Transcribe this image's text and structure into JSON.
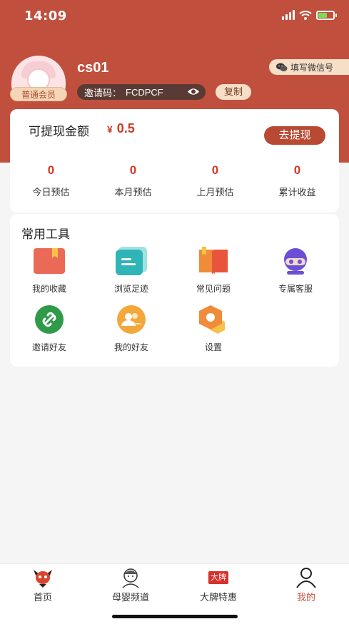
{
  "status_bar": {
    "time": "14:09"
  },
  "profile": {
    "username": "cs01",
    "member_level": "普通会员",
    "invite_label": "邀请码：",
    "invite_code": "FCDPCF",
    "copy_label": "复制",
    "wechat_label": "填写微信号"
  },
  "earnings": {
    "title": "可提现金额",
    "currency": "¥",
    "amount": "0.5",
    "withdraw_label": "去提现",
    "stats": [
      {
        "value": "0",
        "label": "今日预估"
      },
      {
        "value": "0",
        "label": "本月预估"
      },
      {
        "value": "0",
        "label": "上月预估"
      },
      {
        "value": "0",
        "label": "累计收益"
      }
    ]
  },
  "tools": {
    "title": "常用工具",
    "items": [
      {
        "label": "我的收藏",
        "icon": "bookmark-icon"
      },
      {
        "label": "浏览足迹",
        "icon": "history-icon"
      },
      {
        "label": "常见问题",
        "icon": "faq-book-icon"
      },
      {
        "label": "专属客服",
        "icon": "customer-service-icon"
      },
      {
        "label": "邀请好友",
        "icon": "link-icon"
      },
      {
        "label": "我的好友",
        "icon": "friends-icon"
      },
      {
        "label": "设置",
        "icon": "settings-icon"
      }
    ]
  },
  "tabbar": {
    "items": [
      {
        "label": "首页",
        "icon": "home-mascot-icon"
      },
      {
        "label": "母婴频道",
        "icon": "baby-channel-icon"
      },
      {
        "label": "大牌特惠",
        "icon": "brand-deal-icon",
        "badge_text": "大牌"
      },
      {
        "label": "我的",
        "icon": "profile-icon"
      }
    ],
    "active_index": 3
  },
  "colors": {
    "brand": "#c0503d",
    "accent_red": "#d03a24",
    "badge_bg": "#f6dfc6"
  }
}
